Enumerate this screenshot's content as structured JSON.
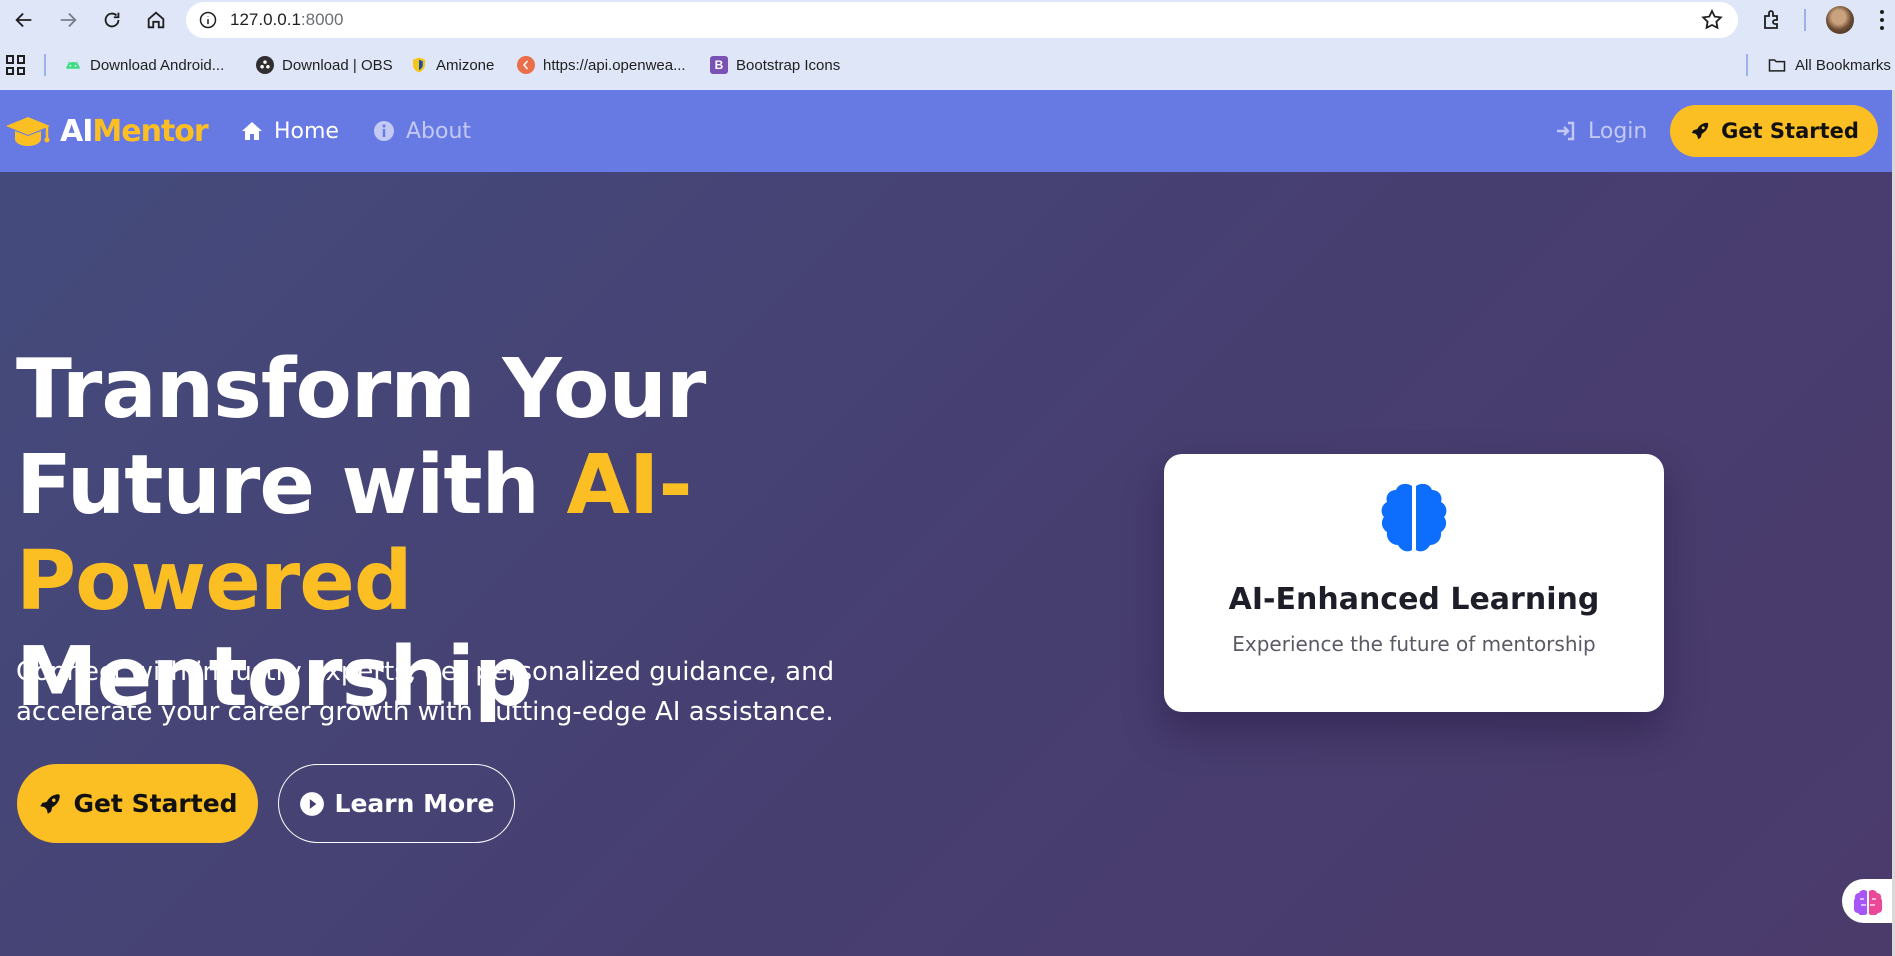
{
  "browser": {
    "url_host": "127.0.0.1",
    "url_port": ":8000",
    "bookmarks": [
      {
        "label": "Download Android...",
        "icon": "android-icon",
        "color": "#3ddc84"
      },
      {
        "label": "Download | OBS",
        "icon": "obs-icon",
        "color": "#302e31"
      },
      {
        "label": "Amizone",
        "icon": "amizone-icon",
        "color": "#1c4fa1"
      },
      {
        "label": "https://api.openwea...",
        "icon": "openweather-icon",
        "color": "#eb6e4b"
      },
      {
        "label": "Bootstrap Icons",
        "icon": "bootstrap-icon",
        "color": "#7952b3"
      }
    ],
    "all_bookmarks_label": "All Bookmarks"
  },
  "navbar": {
    "brand_ai": "AI",
    "brand_mentor": "Mentor",
    "home_label": "Home",
    "about_label": "About",
    "login_label": "Login",
    "cta_label": "Get Started"
  },
  "hero": {
    "title_line1": "Transform Your",
    "title_line2_prefix": "Future with ",
    "title_highlight_line2": "AI-",
    "title_highlight_line3": "Powered",
    "title_line3_suffix": " Mentorship",
    "subtitle": "Connect with industry experts, get personalized guidance, and accelerate your career growth with cutting-edge AI assistance.",
    "primary_button": "Get Started",
    "secondary_button": "Learn More"
  },
  "feature_card": {
    "icon": "brain-icon",
    "title": "AI-Enhanced Learning",
    "description": "Experience the future of mentorship"
  },
  "colors": {
    "accent": "#fbbf24",
    "navbar": "#6779e3",
    "hero_bg": "#473e70",
    "brain": "#0d6efd"
  }
}
